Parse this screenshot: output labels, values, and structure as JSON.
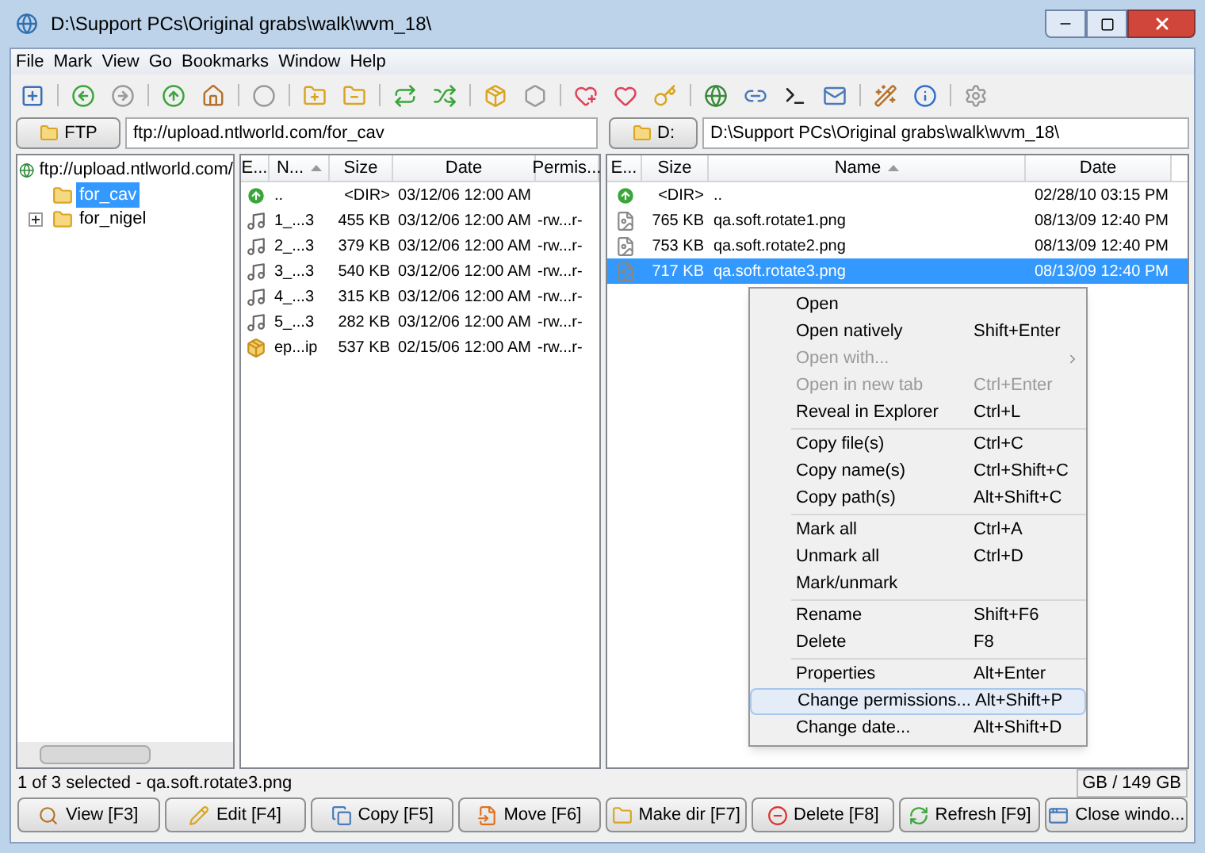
{
  "window": {
    "title": "D:\\Support PCs\\Original grabs\\walk\\wvm_18\\"
  },
  "menu": [
    "File",
    "Mark",
    "View",
    "Go",
    "Bookmarks",
    "Window",
    "Help"
  ],
  "left_address": {
    "button": "FTP",
    "path": "ftp://upload.ntlworld.com/for_cav"
  },
  "right_address": {
    "button": "D:",
    "path": "D:\\Support PCs\\Original grabs\\walk\\wvm_18\\"
  },
  "tree": {
    "label": "ftp://upload.ntlworld.com/",
    "children": [
      {
        "label": "for_cav",
        "selected": true,
        "collapsed": false
      },
      {
        "label": "for_nigel",
        "selected": false,
        "collapsed": true
      }
    ]
  },
  "ftp_list": {
    "columns": [
      {
        "label": "E...",
        "sorted": false
      },
      {
        "label": "N...",
        "sorted": true
      },
      {
        "label": "Size",
        "sorted": false
      },
      {
        "label": "Date",
        "sorted": false
      },
      {
        "label": "Permis...",
        "sorted": false
      }
    ],
    "rows": [
      {
        "kind": "up",
        "name": "..",
        "size": "<DIR>",
        "date": "03/12/06 12:00 AM",
        "permissions": ""
      },
      {
        "kind": "audio",
        "name": "1_...3",
        "size": "455 KB",
        "date": "03/12/06 12:00 AM",
        "permissions": "-rw...r-"
      },
      {
        "kind": "audio",
        "name": "2_...3",
        "size": "379 KB",
        "date": "03/12/06 12:00 AM",
        "permissions": "-rw...r-"
      },
      {
        "kind": "audio",
        "name": "3_...3",
        "size": "540 KB",
        "date": "03/12/06 12:00 AM",
        "permissions": "-rw...r-"
      },
      {
        "kind": "audio",
        "name": "4_...3",
        "size": "315 KB",
        "date": "03/12/06 12:00 AM",
        "permissions": "-rw...r-"
      },
      {
        "kind": "audio",
        "name": "5_...3",
        "size": "282 KB",
        "date": "03/12/06 12:00 AM",
        "permissions": "-rw...r-"
      },
      {
        "kind": "archive",
        "name": "ep...ip",
        "size": "537 KB",
        "date": "02/15/06 12:00 AM",
        "permissions": "-rw...r-"
      }
    ]
  },
  "local_list": {
    "columns": [
      {
        "label": "E...",
        "sorted": false
      },
      {
        "label": "Size",
        "sorted": false
      },
      {
        "label": "Name",
        "sorted": true
      },
      {
        "label": "Date",
        "sorted": false
      }
    ],
    "rows": [
      {
        "kind": "up",
        "size": "<DIR>",
        "name": "..",
        "date": "02/28/10 03:15 PM",
        "selected": false
      },
      {
        "kind": "image",
        "size": "765 KB",
        "name": "qa.soft.rotate1.png",
        "date": "08/13/09 12:40 PM",
        "selected": false
      },
      {
        "kind": "image",
        "size": "753 KB",
        "name": "qa.soft.rotate2.png",
        "date": "08/13/09 12:40 PM",
        "selected": false
      },
      {
        "kind": "image",
        "size": "717 KB",
        "name": "qa.soft.rotate3.png",
        "date": "08/13/09 12:40 PM",
        "selected": true
      }
    ]
  },
  "context_menu": [
    [
      {
        "label": "Open",
        "disabled": false,
        "submenu": false,
        "hovered": false
      },
      {
        "label": "Open natively",
        "shortcut": "Shift+Enter",
        "disabled": false,
        "submenu": false,
        "hovered": false
      },
      {
        "label": "Open with...",
        "disabled": true,
        "submenu": true,
        "hovered": false
      },
      {
        "label": "Open in new tab",
        "shortcut": "Ctrl+Enter",
        "disabled": true,
        "submenu": false,
        "hovered": false
      },
      {
        "label": "Reveal in Explorer",
        "shortcut": "Ctrl+L",
        "disabled": false,
        "submenu": false,
        "hovered": false
      }
    ],
    [
      {
        "label": "Copy file(s)",
        "shortcut": "Ctrl+C",
        "disabled": false,
        "submenu": false,
        "hovered": false
      },
      {
        "label": "Copy name(s)",
        "shortcut": "Ctrl+Shift+C",
        "disabled": false,
        "submenu": false,
        "hovered": false
      },
      {
        "label": "Copy path(s)",
        "shortcut": "Alt+Shift+C",
        "disabled": false,
        "submenu": false,
        "hovered": false
      }
    ],
    [
      {
        "label": "Mark all",
        "shortcut": "Ctrl+A",
        "disabled": false,
        "submenu": false,
        "hovered": false
      },
      {
        "label": "Unmark all",
        "shortcut": "Ctrl+D",
        "disabled": false,
        "submenu": false,
        "hovered": false
      },
      {
        "label": "Mark/unmark",
        "disabled": false,
        "submenu": false,
        "hovered": false
      }
    ],
    [
      {
        "label": "Rename",
        "shortcut": "Shift+F6",
        "disabled": false,
        "submenu": false,
        "hovered": false
      },
      {
        "label": "Delete",
        "shortcut": "F8",
        "disabled": false,
        "submenu": false,
        "hovered": false
      }
    ],
    [
      {
        "label": "Properties",
        "shortcut": "Alt+Enter",
        "disabled": false,
        "submenu": false,
        "hovered": false
      },
      {
        "label": "Change permissions...",
        "shortcut": "Alt+Shift+P",
        "disabled": false,
        "submenu": false,
        "hovered": true
      },
      {
        "label": "Change date...",
        "shortcut": "Alt+Shift+D",
        "disabled": false,
        "submenu": false,
        "hovered": false
      }
    ]
  ],
  "status_bar": {
    "selection": "1 of 3 selected - qa.soft.rotate3.png",
    "disk": "GB / 149 GB"
  },
  "buttons": [
    {
      "kind": "view",
      "label": "View [F3]"
    },
    {
      "kind": "edit",
      "label": "Edit [F4]"
    },
    {
      "kind": "copy",
      "label": "Copy [F5]"
    },
    {
      "kind": "move",
      "label": "Move [F6]"
    },
    {
      "kind": "mkdir",
      "label": "Make dir [F7]"
    },
    {
      "kind": "delete",
      "label": "Delete [F8]"
    },
    {
      "kind": "refresh",
      "label": "Refresh [F9]"
    },
    {
      "kind": "close",
      "label": "Close windo..."
    }
  ]
}
